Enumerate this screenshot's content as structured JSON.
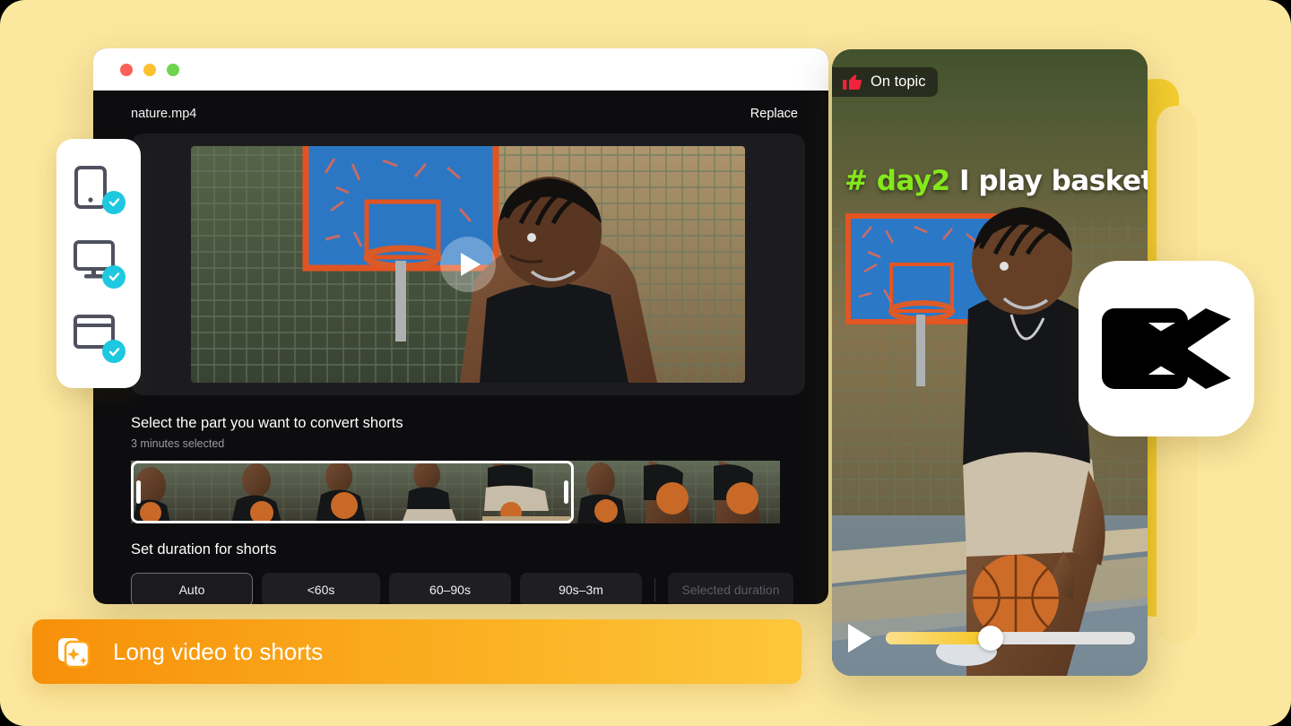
{
  "page": {
    "background_color": "#FCE79E"
  },
  "window": {
    "traffic_lights": [
      {
        "name": "close",
        "color": "#FC6058"
      },
      {
        "name": "minimize",
        "color": "#FDC02F"
      },
      {
        "name": "maximize",
        "color": "#6FD44B"
      }
    ],
    "file_name": "nature.mp4",
    "replace_label": "Replace",
    "preview": {
      "play_button_icon": "play-icon"
    },
    "convert_section": {
      "title": "Select the part you want to convert shorts",
      "selection_info": "3 minutes selected"
    },
    "duration_section": {
      "title": "Set duration for shorts",
      "options": [
        {
          "label": "Auto",
          "selected": true,
          "disabled": false
        },
        {
          "label": "<60s",
          "selected": false,
          "disabled": false
        },
        {
          "label": "60–90s",
          "selected": false,
          "disabled": false
        },
        {
          "label": "90s–3m",
          "selected": false,
          "disabled": false
        },
        {
          "label": "Selected duration",
          "selected": false,
          "disabled": true
        }
      ]
    }
  },
  "devices_card": {
    "items": [
      {
        "icon": "mobile-phone-icon",
        "checked": true
      },
      {
        "icon": "desktop-monitor-icon",
        "checked": true
      },
      {
        "icon": "browser-window-icon",
        "checked": true
      }
    ],
    "check_color": "#1EC8E0"
  },
  "phone_preview": {
    "badge": {
      "icon": "thumbs-up-icon",
      "icon_color": "#F0233D",
      "label": "On topic"
    },
    "caption": {
      "highlight": "# day2",
      "highlight_color": "#84E81B",
      "rest": " I play basketball",
      "rest_color": "#FFFFFF"
    },
    "player": {
      "play_icon": "play-icon",
      "progress_percent": 42,
      "fill_color": "#F5C521"
    }
  },
  "logo": {
    "name": "capcut-logo"
  },
  "banner": {
    "icon": "shorts-stack-icon",
    "label": "Long video to shorts",
    "gradient_from": "#F79009",
    "gradient_to": "#FDC73C"
  }
}
